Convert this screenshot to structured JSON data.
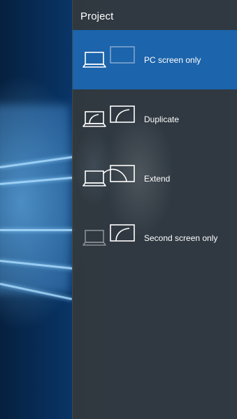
{
  "flyout": {
    "title": "Project",
    "options": [
      {
        "label": "PC screen only",
        "selected": true,
        "icon": "pc-screen-only-icon"
      },
      {
        "label": "Duplicate",
        "selected": false,
        "icon": "duplicate-icon"
      },
      {
        "label": "Extend",
        "selected": false,
        "icon": "extend-icon"
      },
      {
        "label": "Second screen only",
        "selected": false,
        "icon": "second-screen-only-icon"
      }
    ]
  },
  "colors": {
    "selected_bg": "#1c64ab",
    "flyout_bg": "#34383c",
    "desktop_blue": "#0c4a8c"
  }
}
